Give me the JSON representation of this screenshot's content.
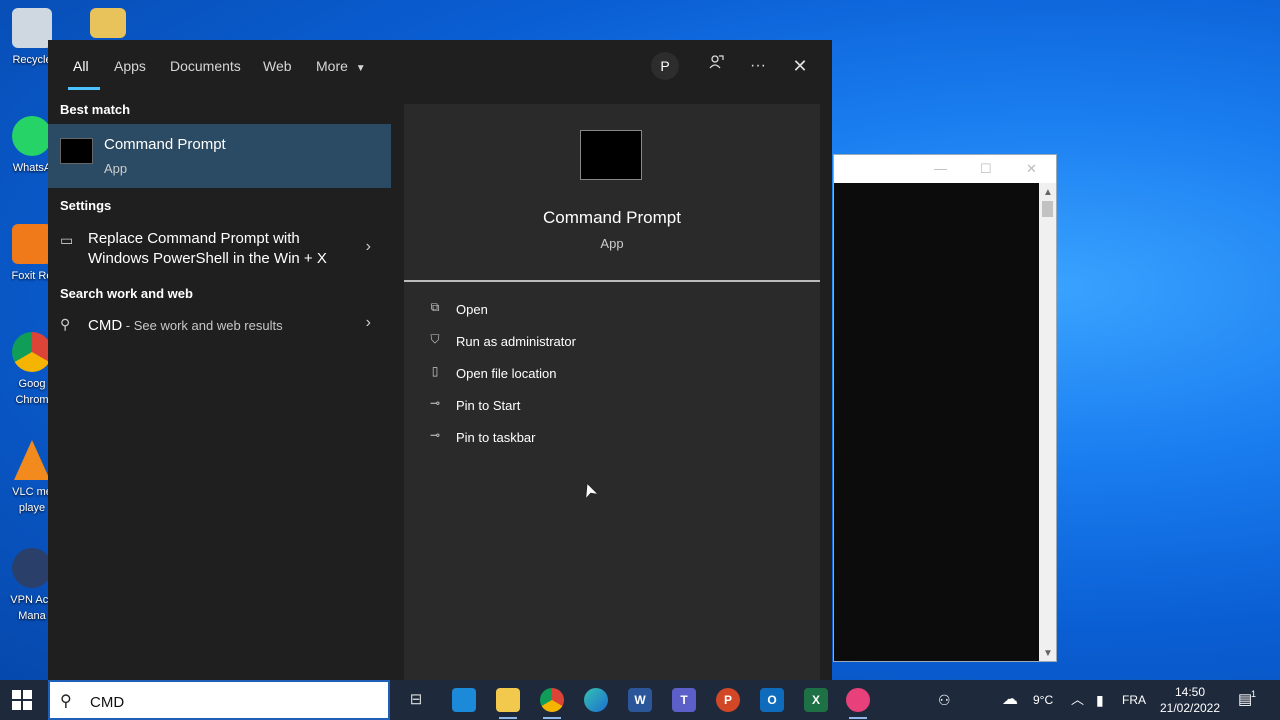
{
  "desktop": {
    "icons": [
      {
        "label": "Recycle"
      },
      {
        "label": "WhatsA"
      },
      {
        "label": "Foxit Re"
      },
      {
        "label": "Goog Chrom"
      },
      {
        "label": "VLC me playe"
      },
      {
        "label": "VPN Acc Mana"
      }
    ]
  },
  "search_panel": {
    "tabs": [
      {
        "label": "All"
      },
      {
        "label": "Apps"
      },
      {
        "label": "Documents"
      },
      {
        "label": "Web"
      },
      {
        "label": "More"
      }
    ],
    "avatar_initial": "P",
    "best_match": {
      "header": "Best match",
      "name": "Command Prompt",
      "type": "App"
    },
    "settings": {
      "header": "Settings",
      "item_line1": "Replace Command Prompt with",
      "item_line2": "Windows PowerShell in the Win + X"
    },
    "web": {
      "header": "Search work and web",
      "query": "CMD",
      "suffix": " - See work and web results"
    },
    "preview": {
      "name": "Command Prompt",
      "type": "App",
      "actions": [
        {
          "label": "Open"
        },
        {
          "label": "Run as administrator"
        },
        {
          "label": "Open file location"
        },
        {
          "label": "Pin to Start"
        },
        {
          "label": "Pin to taskbar"
        }
      ]
    }
  },
  "search_box": {
    "value": "CMD"
  },
  "taskbar": {
    "weather": "9°C",
    "language": "FRA",
    "time": "14:50",
    "date": "21/02/2022",
    "notification_count": "1"
  },
  "colors": {
    "accent": "#4cc2ff",
    "selected_row": "#2b4a63",
    "panel_bg": "#1f1f1f"
  }
}
